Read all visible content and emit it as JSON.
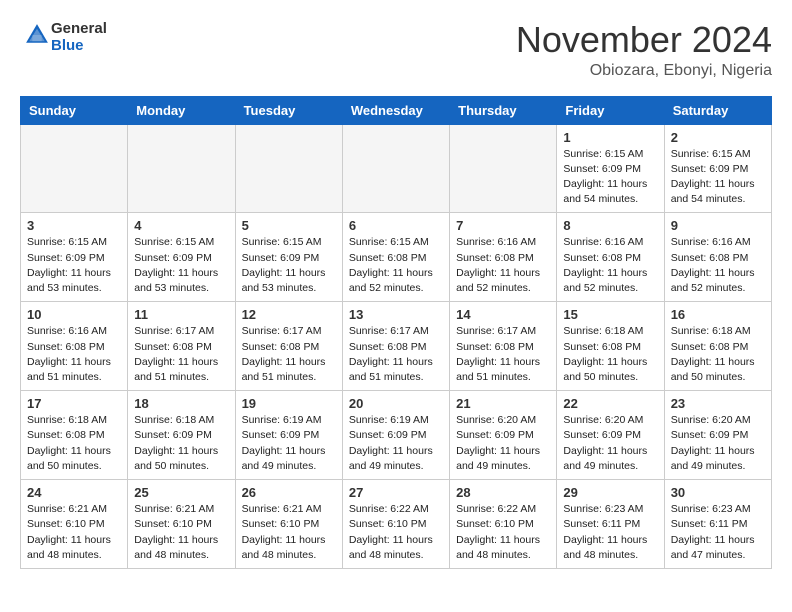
{
  "logo": {
    "general": "General",
    "blue": "Blue"
  },
  "title": "November 2024",
  "subtitle": "Obiozara, Ebonyi, Nigeria",
  "weekdays": [
    "Sunday",
    "Monday",
    "Tuesday",
    "Wednesday",
    "Thursday",
    "Friday",
    "Saturday"
  ],
  "weeks": [
    [
      {
        "day": "",
        "info": ""
      },
      {
        "day": "",
        "info": ""
      },
      {
        "day": "",
        "info": ""
      },
      {
        "day": "",
        "info": ""
      },
      {
        "day": "",
        "info": ""
      },
      {
        "day": "1",
        "info": "Sunrise: 6:15 AM\nSunset: 6:09 PM\nDaylight: 11 hours\nand 54 minutes."
      },
      {
        "day": "2",
        "info": "Sunrise: 6:15 AM\nSunset: 6:09 PM\nDaylight: 11 hours\nand 54 minutes."
      }
    ],
    [
      {
        "day": "3",
        "info": "Sunrise: 6:15 AM\nSunset: 6:09 PM\nDaylight: 11 hours\nand 53 minutes."
      },
      {
        "day": "4",
        "info": "Sunrise: 6:15 AM\nSunset: 6:09 PM\nDaylight: 11 hours\nand 53 minutes."
      },
      {
        "day": "5",
        "info": "Sunrise: 6:15 AM\nSunset: 6:09 PM\nDaylight: 11 hours\nand 53 minutes."
      },
      {
        "day": "6",
        "info": "Sunrise: 6:15 AM\nSunset: 6:08 PM\nDaylight: 11 hours\nand 52 minutes."
      },
      {
        "day": "7",
        "info": "Sunrise: 6:16 AM\nSunset: 6:08 PM\nDaylight: 11 hours\nand 52 minutes."
      },
      {
        "day": "8",
        "info": "Sunrise: 6:16 AM\nSunset: 6:08 PM\nDaylight: 11 hours\nand 52 minutes."
      },
      {
        "day": "9",
        "info": "Sunrise: 6:16 AM\nSunset: 6:08 PM\nDaylight: 11 hours\nand 52 minutes."
      }
    ],
    [
      {
        "day": "10",
        "info": "Sunrise: 6:16 AM\nSunset: 6:08 PM\nDaylight: 11 hours\nand 51 minutes."
      },
      {
        "day": "11",
        "info": "Sunrise: 6:17 AM\nSunset: 6:08 PM\nDaylight: 11 hours\nand 51 minutes."
      },
      {
        "day": "12",
        "info": "Sunrise: 6:17 AM\nSunset: 6:08 PM\nDaylight: 11 hours\nand 51 minutes."
      },
      {
        "day": "13",
        "info": "Sunrise: 6:17 AM\nSunset: 6:08 PM\nDaylight: 11 hours\nand 51 minutes."
      },
      {
        "day": "14",
        "info": "Sunrise: 6:17 AM\nSunset: 6:08 PM\nDaylight: 11 hours\nand 51 minutes."
      },
      {
        "day": "15",
        "info": "Sunrise: 6:18 AM\nSunset: 6:08 PM\nDaylight: 11 hours\nand 50 minutes."
      },
      {
        "day": "16",
        "info": "Sunrise: 6:18 AM\nSunset: 6:08 PM\nDaylight: 11 hours\nand 50 minutes."
      }
    ],
    [
      {
        "day": "17",
        "info": "Sunrise: 6:18 AM\nSunset: 6:08 PM\nDaylight: 11 hours\nand 50 minutes."
      },
      {
        "day": "18",
        "info": "Sunrise: 6:18 AM\nSunset: 6:09 PM\nDaylight: 11 hours\nand 50 minutes."
      },
      {
        "day": "19",
        "info": "Sunrise: 6:19 AM\nSunset: 6:09 PM\nDaylight: 11 hours\nand 49 minutes."
      },
      {
        "day": "20",
        "info": "Sunrise: 6:19 AM\nSunset: 6:09 PM\nDaylight: 11 hours\nand 49 minutes."
      },
      {
        "day": "21",
        "info": "Sunrise: 6:20 AM\nSunset: 6:09 PM\nDaylight: 11 hours\nand 49 minutes."
      },
      {
        "day": "22",
        "info": "Sunrise: 6:20 AM\nSunset: 6:09 PM\nDaylight: 11 hours\nand 49 minutes."
      },
      {
        "day": "23",
        "info": "Sunrise: 6:20 AM\nSunset: 6:09 PM\nDaylight: 11 hours\nand 49 minutes."
      }
    ],
    [
      {
        "day": "24",
        "info": "Sunrise: 6:21 AM\nSunset: 6:10 PM\nDaylight: 11 hours\nand 48 minutes."
      },
      {
        "day": "25",
        "info": "Sunrise: 6:21 AM\nSunset: 6:10 PM\nDaylight: 11 hours\nand 48 minutes."
      },
      {
        "day": "26",
        "info": "Sunrise: 6:21 AM\nSunset: 6:10 PM\nDaylight: 11 hours\nand 48 minutes."
      },
      {
        "day": "27",
        "info": "Sunrise: 6:22 AM\nSunset: 6:10 PM\nDaylight: 11 hours\nand 48 minutes."
      },
      {
        "day": "28",
        "info": "Sunrise: 6:22 AM\nSunset: 6:10 PM\nDaylight: 11 hours\nand 48 minutes."
      },
      {
        "day": "29",
        "info": "Sunrise: 6:23 AM\nSunset: 6:11 PM\nDaylight: 11 hours\nand 48 minutes."
      },
      {
        "day": "30",
        "info": "Sunrise: 6:23 AM\nSunset: 6:11 PM\nDaylight: 11 hours\nand 47 minutes."
      }
    ]
  ]
}
